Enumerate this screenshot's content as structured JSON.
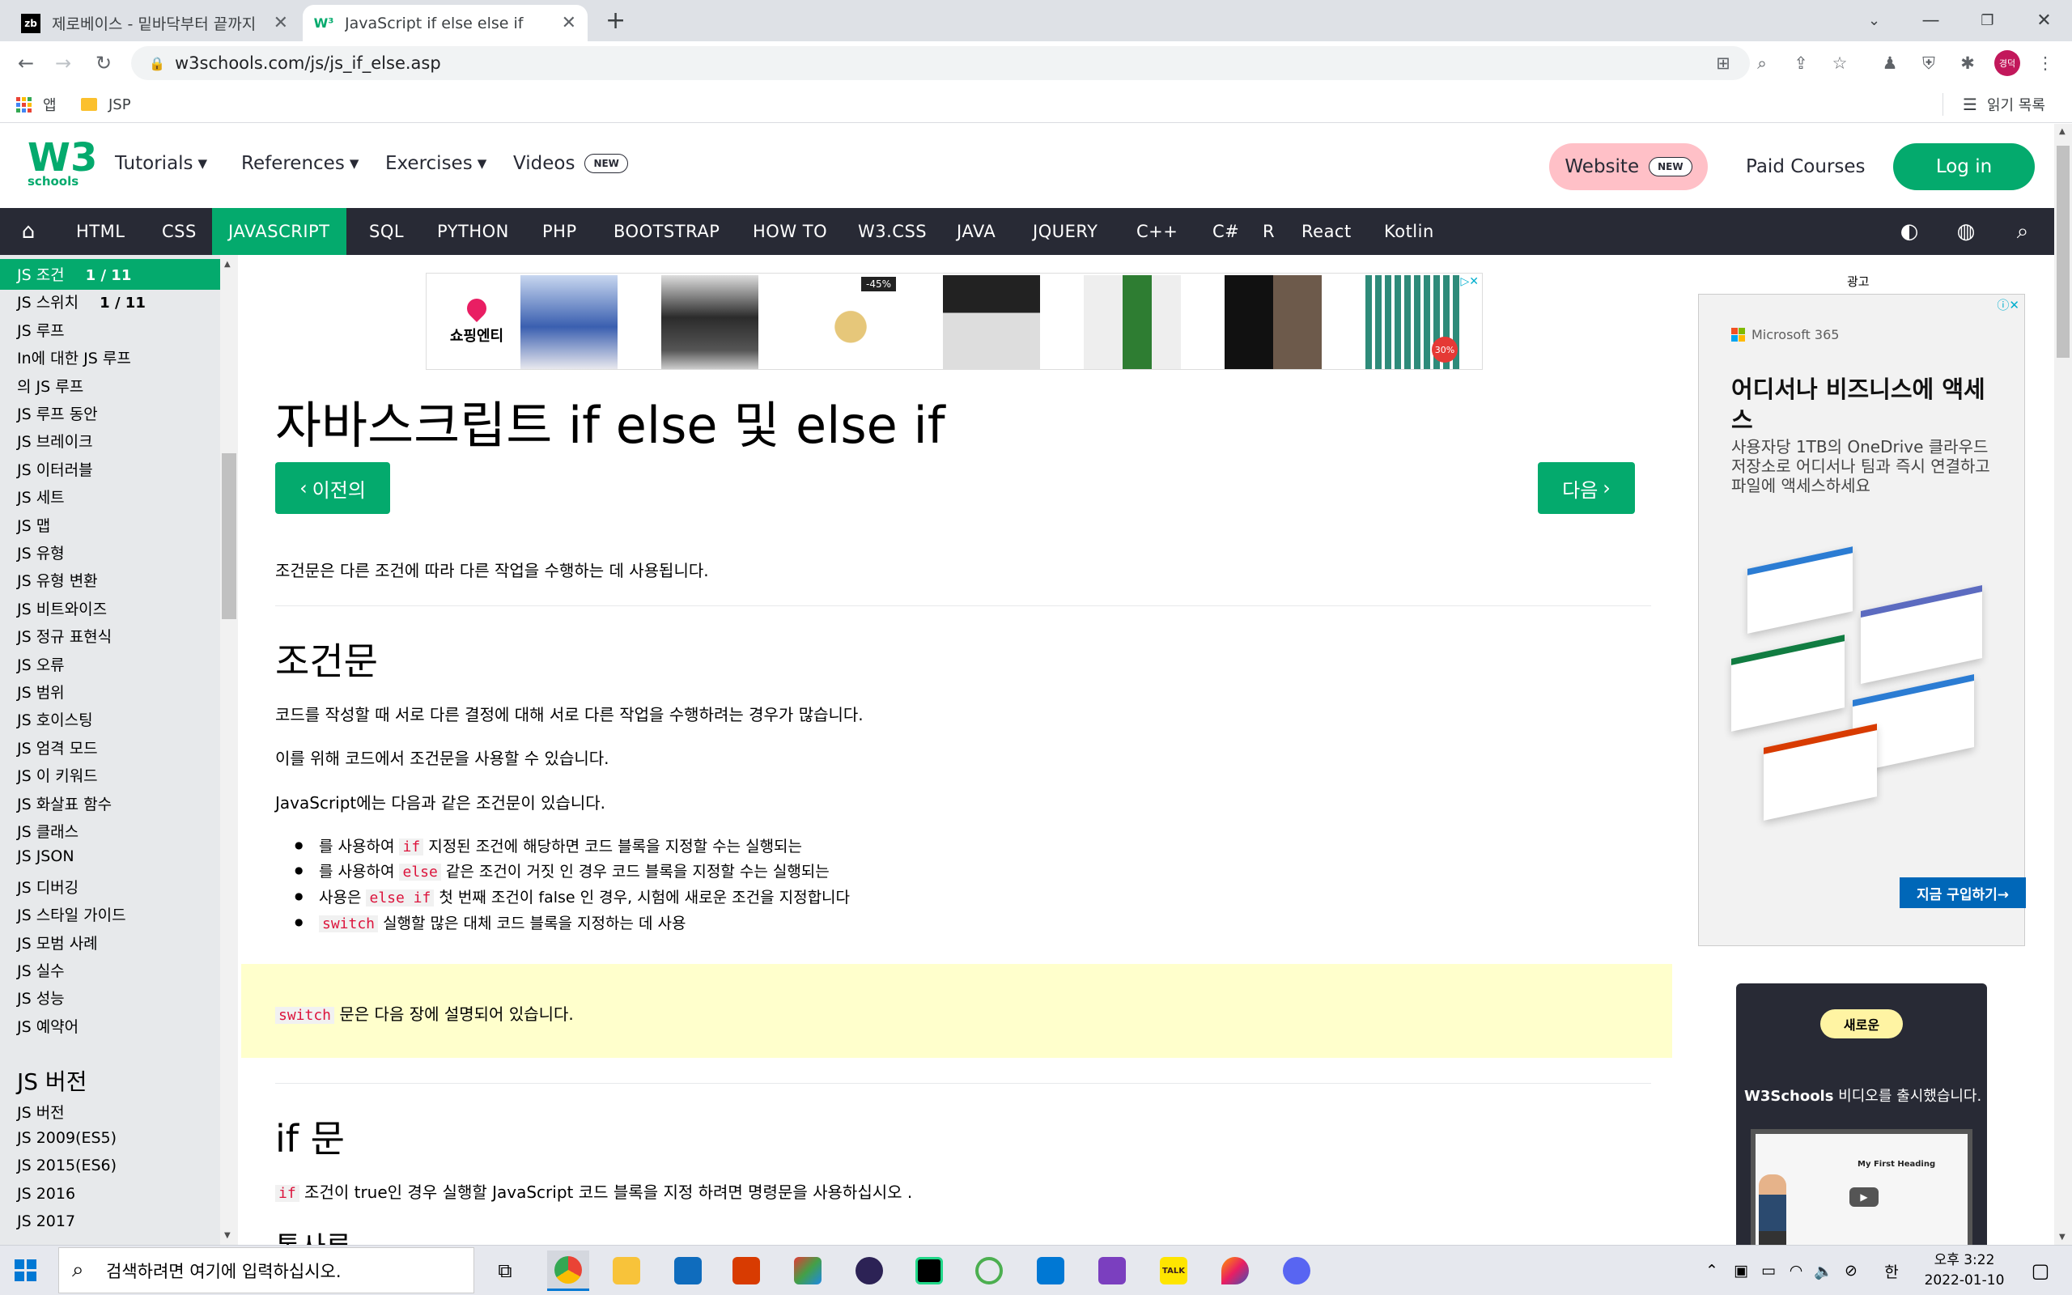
{
  "browser": {
    "tabs": [
      {
        "title": "제로베이스 - 밑바닥부터 끝까지",
        "favicon": "zb",
        "active": false
      },
      {
        "title": "JavaScript if else else if",
        "favicon": "w3",
        "active": true
      }
    ],
    "new_tab_label": "+",
    "address": "w3schools.com/js/js_if_else.asp",
    "profile_initials": "경덕",
    "bookmarks": {
      "apps_label": "앱",
      "folder_label": "JSP",
      "reading_list_label": "읽기 목록"
    }
  },
  "w3": {
    "logo_text": "W3",
    "logo_sub": "schools",
    "menu": [
      {
        "label": "Tutorials"
      },
      {
        "label": "References"
      },
      {
        "label": "Exercises"
      },
      {
        "label": "Videos",
        "badge": "NEW"
      }
    ],
    "website_label": "Website",
    "website_badge": "NEW",
    "paid_courses": "Paid Courses",
    "login": "Log in",
    "topnav": [
      "HTML",
      "CSS",
      "JAVASCRIPT",
      "SQL",
      "PYTHON",
      "PHP",
      "BOOTSTRAP",
      "HOW TO",
      "W3.CSS",
      "JAVA",
      "JQUERY",
      "C++",
      "C#",
      "R",
      "React",
      "Kotlin"
    ],
    "topnav_active": "JAVASCRIPT"
  },
  "sidebar": {
    "items": [
      {
        "label": "JS 조건",
        "suffix": "1 / 11"
      },
      {
        "label": "JS 스위치",
        "suffix": "1 / 11"
      },
      {
        "label": "JS 루프"
      },
      {
        "label": "In에 대한 JS 루프"
      },
      {
        "label": "의 JS 루프"
      },
      {
        "label": "JS 루프 동안"
      },
      {
        "label": "JS 브레이크"
      },
      {
        "label": "JS 이터러블"
      },
      {
        "label": "JS 세트"
      },
      {
        "label": "JS 맵"
      },
      {
        "label": "JS 유형"
      },
      {
        "label": "JS 유형 변환"
      },
      {
        "label": "JS 비트와이즈"
      },
      {
        "label": "JS 정규 표현식"
      },
      {
        "label": "JS 오류"
      },
      {
        "label": "JS 범위"
      },
      {
        "label": "JS 호이스팅"
      },
      {
        "label": "JS 엄격 모드"
      },
      {
        "label": "JS 이 키워드"
      },
      {
        "label": "JS 화살표 함수"
      },
      {
        "label": "JS 클래스"
      },
      {
        "label": "JS JSON"
      },
      {
        "label": "JS 디버깅"
      },
      {
        "label": "JS 스타일 가이드"
      },
      {
        "label": "JS 모범 사례"
      },
      {
        "label": "JS 실수"
      },
      {
        "label": "JS 성능"
      },
      {
        "label": "JS 예약어"
      }
    ],
    "section_heading": "JS 버전",
    "versions": [
      "JS 버전",
      "JS 2009(ES5)",
      "JS 2015(ES6)",
      "JS 2016",
      "JS 2017"
    ]
  },
  "main": {
    "ad_shop_name": "쇼핑엔티",
    "ad_discount": "-45%",
    "ad_badge": "30%",
    "title": "자바스크립트 if else 및 else if",
    "prev_label": "이전의",
    "next_label": "다음",
    "intro": "조건문은 다른 조건에 따라 다른 작업을 수행하는 데 사용됩니다.",
    "h2_conditional": "조건문",
    "p1": "코드를 작성할 때 서로 다른 결정에 대해 서로 다른 작업을 수행하려는 경우가 많습니다.",
    "p2": "이를 위해 코드에서 조건문을 사용할 수 있습니다.",
    "p3": "JavaScript에는 다음과 같은 조건문이 있습니다.",
    "bullets": [
      {
        "pre": "를 사용하여 ",
        "code": "if",
        "post": " 지정된 조건에 해당하면 코드 블록을 지정할 수는 실행되는"
      },
      {
        "pre": "를 사용하여 ",
        "code": "else",
        "post": " 같은 조건이 거짓 인 경우 코드 블록을 지정할 수는 실행되는"
      },
      {
        "pre": "사용은 ",
        "code": "else if",
        "post": " 첫 번째 조건이 false 인 경우, 시험에 새로운 조건을 지정합니다"
      },
      {
        "pre": "",
        "code": "switch",
        "post": " 실행할 많은 대체 코드 블록을 지정하는 데 사용"
      }
    ],
    "note_code": "switch",
    "note_text": " 문은 다음 장에 설명되어 있습니다.",
    "h2_if": "if 문",
    "if_code": "if",
    "if_text": " 조건이 true인 경우 실행할 JavaScript 코드 블록을 지정 하려면 명령문을 사용하십시오 .",
    "syntax_heading": "통사론"
  },
  "right": {
    "ad_label": "광고",
    "ms_brand": "Microsoft 365",
    "ms_title": "어디서나 비즈니스에 액세스",
    "ms_body": "사용자당 1TB의 OneDrive 클라우드 저장소로 어디서나 팀과 즉시 연결하고 파일에 액세스하세요",
    "ms_cta": "지금 구입하기→",
    "video_badge": "새로운",
    "video_brand": "W3Schools",
    "video_text": " 비디오를 출시했습니다.",
    "video_screen_title": "My First Heading"
  },
  "taskbar": {
    "search_placeholder": "검색하려면 여기에 입력하십시오.",
    "ime": "한",
    "time": "오후 3:22",
    "date": "2022-01-10",
    "kakao_label": "TALK"
  },
  "colors": {
    "w3_green": "#04aa6d",
    "w3_dark": "#282a35",
    "note_yellow": "#ffffcc",
    "code_red": "#dc143c"
  }
}
